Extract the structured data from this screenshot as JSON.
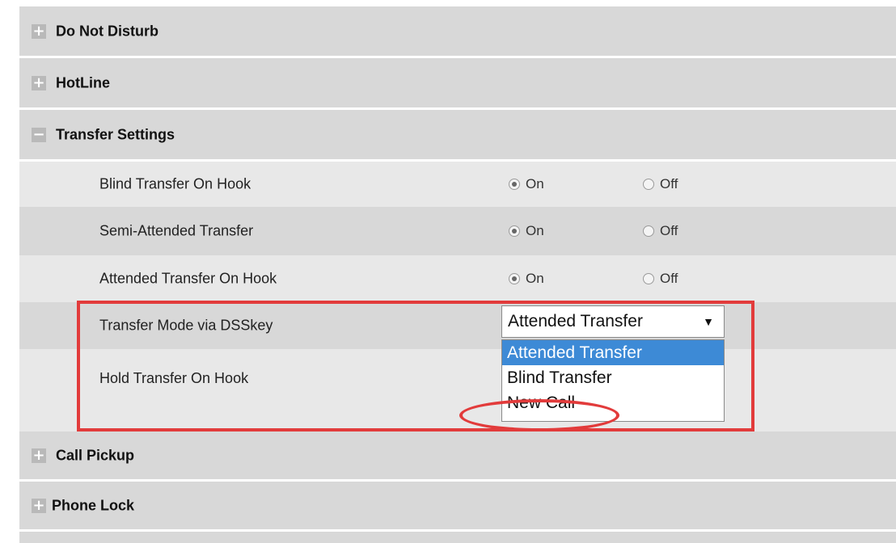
{
  "sections": {
    "do_not_disturb": {
      "toggle": "+",
      "title": "Do Not Disturb"
    },
    "hotline": {
      "toggle": "+",
      "title": "HotLine"
    },
    "transfer_settings": {
      "toggle": "−",
      "title": "Transfer Settings"
    },
    "call_pickup": {
      "toggle": "+",
      "title": "Call Pickup"
    },
    "phone_lock": {
      "toggle": "+",
      "title": "Phone Lock"
    }
  },
  "transfer": {
    "blind_on_hook": {
      "label": "Blind Transfer On Hook",
      "on": "On",
      "off": "Off",
      "selected": "On"
    },
    "semi_attended": {
      "label": "Semi-Attended Transfer",
      "on": "On",
      "off": "Off",
      "selected": "On"
    },
    "attended_on_hook": {
      "label": "Attended Transfer On Hook",
      "on": "On",
      "off": "Off",
      "selected": "On"
    },
    "mode_dsskey": {
      "label": "Transfer Mode via DSSkey",
      "value": "Attended Transfer",
      "arrow": "▼",
      "options": [
        "Attended Transfer",
        "Blind Transfer",
        "New Call"
      ]
    },
    "hold_on_hook": {
      "label": "Hold Transfer On Hook"
    }
  },
  "colors": {
    "section_bg": "#d8d8d8",
    "row_bg_light": "#e8e8e8",
    "highlight": "#e23b3b",
    "option_selected": "#3d8ad6"
  }
}
